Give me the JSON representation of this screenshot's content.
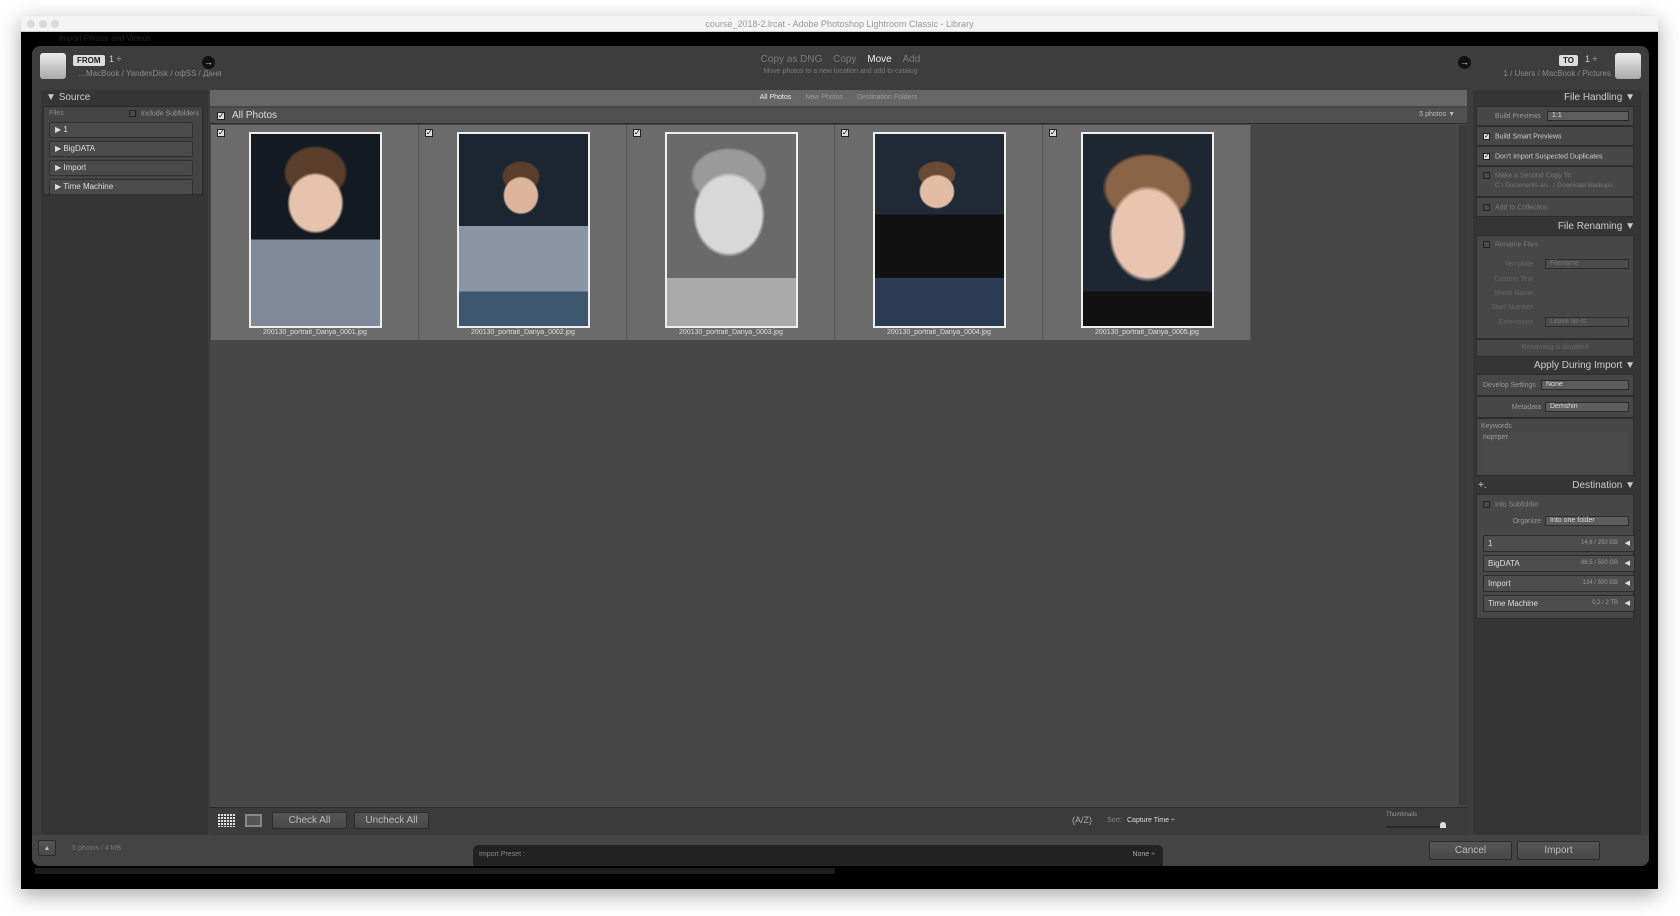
{
  "window": {
    "title": "course_2018-2.lrcat - Adobe Photoshop Lightroom Classic - Library",
    "behind_title": "Import Photos and Videos"
  },
  "header": {
    "from_badge": "FROM",
    "from_value": "1 ÷",
    "from_path": "…MacBook / YandexDisk / офSS / Даня",
    "to_badge": "TO",
    "to_value": "1 ÷",
    "to_path": "1 / Users / MacBook / Pictures",
    "modes": [
      "Copy as DNG",
      "Copy",
      "Move",
      "Add"
    ],
    "active_mode": "Move",
    "mode_desc": "Move photos to a new location and add to catalog"
  },
  "source": {
    "title": "Source",
    "files_label": "Files",
    "include_subfolders": "Include Subfolders",
    "items": [
      "1",
      "BigDATA",
      "Import",
      "Time Machine"
    ]
  },
  "grid": {
    "tabs": [
      "All Photos",
      "New Photos",
      "Destination Folders"
    ],
    "active_tab": "All Photos",
    "all_photos_label": "All Photos",
    "count": "5 photos",
    "photos": [
      {
        "name": "200130_portrait_Danya_0001.jpg",
        "checked": true
      },
      {
        "name": "200130_portrait_Danya_0002.jpg",
        "checked": true
      },
      {
        "name": "200130_portrait_Danya_0003.jpg",
        "checked": true
      },
      {
        "name": "200130_portrait_Danya_0004.jpg",
        "checked": true
      },
      {
        "name": "200130_portrait_Danya_0005.jpg",
        "checked": true
      }
    ]
  },
  "toolbar": {
    "check_all": "Check All",
    "uncheck_all": "Uncheck All",
    "sort_label": "Sort:",
    "sort_value": "Capture Time ÷",
    "thumbnails_label": "Thumbnails",
    "thumbnail_size": 1.0
  },
  "file_handling": {
    "title": "File Handling",
    "build_previews_label": "Build Previews",
    "build_previews_value": "1:1",
    "build_smart_previews": "Build Smart Previews",
    "dont_import_duplicates": "Don't Import Suspected Duplicates",
    "second_copy": "Make a Second Copy To :",
    "second_copy_path": "C:\\ Documents an…\\ Download Backups",
    "add_to_collection": "Add to Collection"
  },
  "file_renaming": {
    "title": "File Renaming",
    "rename_files": "Rename Files",
    "template_label": "Template",
    "template_value": "Filename",
    "custom_text": "Custom Text",
    "shoot_name": "Shoot Name",
    "start_number": "Start Number",
    "extensions_label": "Extensions",
    "extensions_value": "Leave as-is",
    "status": "Renaming is disabled"
  },
  "apply": {
    "title": "Apply During Import",
    "develop_label": "Develop Settings",
    "develop_value": "None",
    "metadata_label": "Metadata",
    "metadata_value": "Demshin",
    "keywords_label": "Keywords",
    "keywords_value": "портрет"
  },
  "destination": {
    "title": "Destination",
    "plus": "+.",
    "into_subfolder": "Into Subfolder",
    "organize_label": "Organize",
    "organize_value": "Into one folder",
    "volumes": [
      {
        "name": "1",
        "size": "14,6 / 250 GB"
      },
      {
        "name": "BigDATA",
        "size": "88,5 / 500 GB"
      },
      {
        "name": "Import",
        "size": "134 / 500 GB"
      },
      {
        "name": "Time Machine",
        "size": "0,2 / 2 TB"
      }
    ]
  },
  "footer": {
    "summary": "5 photos / 4 MB",
    "import_preset_label": "Import Preset :",
    "import_preset_value": "None ÷",
    "cancel": "Cancel",
    "import": "Import"
  }
}
